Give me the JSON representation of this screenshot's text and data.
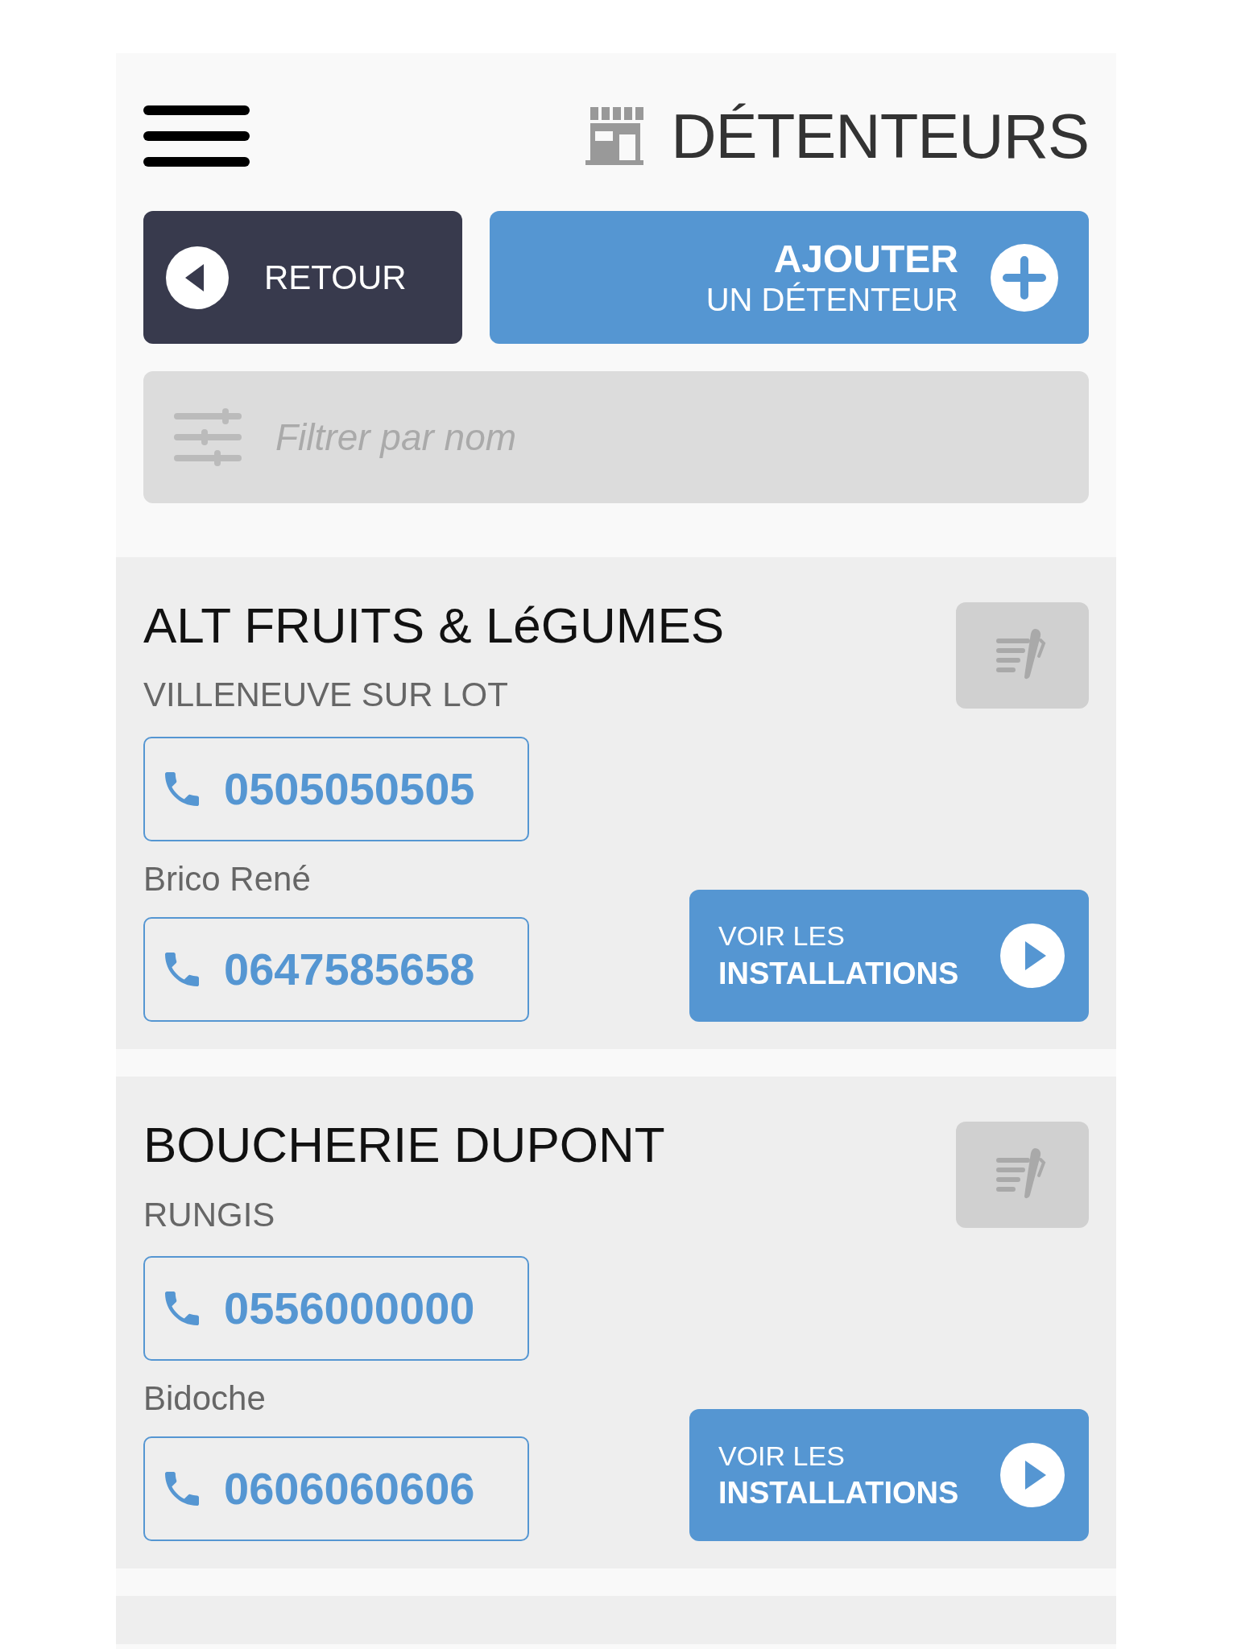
{
  "header": {
    "title": "DÉTENTEURS"
  },
  "actions": {
    "back": "RETOUR",
    "add_line1": "AJOUTER",
    "add_line2": "UN DÉTENTEUR"
  },
  "filter": {
    "placeholder": "Filtrer par nom"
  },
  "holders": [
    {
      "name": "ALT FRUITS & LéGUMES",
      "city": "VILLENEUVE SUR LOT",
      "phone": "0505050505",
      "contact": "Brico René",
      "contact_phone": "0647585658",
      "link_line1": "VOIR LES",
      "link_line2": "INSTALLATIONS"
    },
    {
      "name": "BOUCHERIE DUPONT",
      "city": "RUNGIS",
      "phone": "0556000000",
      "contact": "Bidoche",
      "contact_phone": "0606060606",
      "link_line1": "VOIR LES",
      "link_line2": "INSTALLATIONS"
    }
  ],
  "next_card_partial": true
}
